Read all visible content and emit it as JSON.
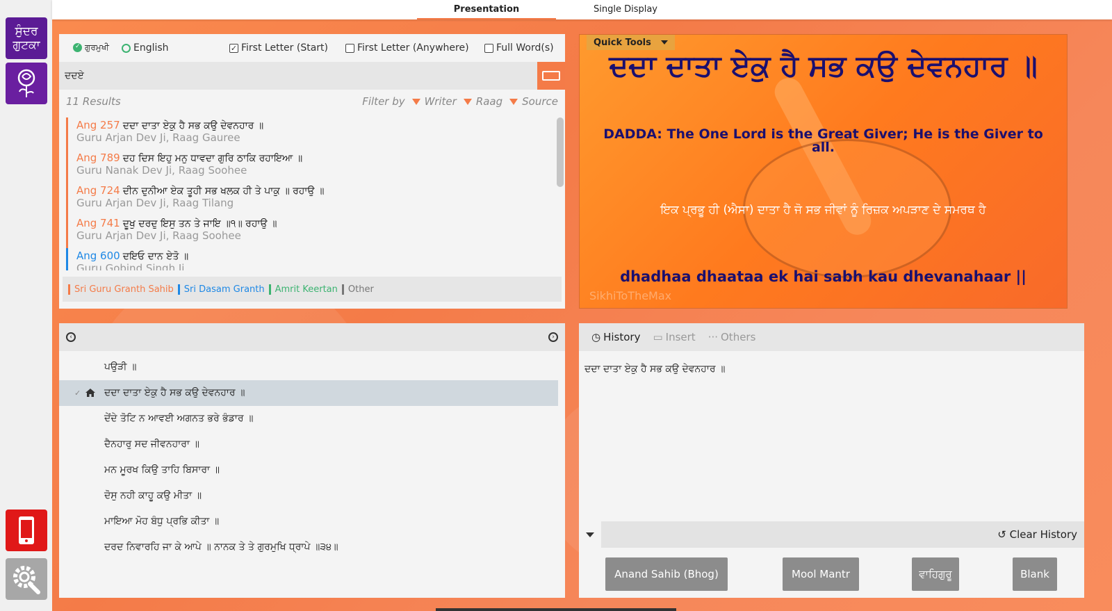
{
  "sidebar": {
    "gutka_label": "ਸੁੰਦਰ ਗੁਟਕਾ",
    "icons": [
      "rose-icon",
      "mobile-icon",
      "settings-icon"
    ]
  },
  "tabs": {
    "presentation": "Presentation",
    "single_display": "Single Display"
  },
  "search": {
    "options": {
      "gurmukhi": "ਗੁਰਮੁਖੀ",
      "english": "English",
      "first_letter_start": "First Letter (Start)",
      "first_letter_anywhere": "First Letter (Anywhere)",
      "full_words": "Full Word(s)"
    },
    "query": "ਦਦਏ",
    "results_count": "11 Results",
    "filter_by": "Filter by",
    "filters": [
      "Writer",
      "Raag",
      "Source"
    ],
    "results": [
      {
        "ang": "Ang 257",
        "text": "ਦਦਾ ਦਾਤਾ ਏਕੁ ਹੈ ਸਭ ਕਉ ਦੇਵਨਹਾਰ ॥",
        "sub": "Guru Arjan Dev Ji, Raag Gauree"
      },
      {
        "ang": "Ang 789",
        "text": "ਦਹ ਦਿਸ ਇਹੁ ਮਨੁ ਧਾਵਦਾ ਗੁਰਿ ਠਾਕਿ ਰਹਾਇਆ ॥",
        "sub": "Guru Nanak Dev Ji, Raag Soohee"
      },
      {
        "ang": "Ang 724",
        "text": "ਦੀਨ ਦੁਨੀਆ ਏਕ ਤੂਹੀ ਸਭ ਖਲਕ ਹੀ ਤੇ ਪਾਕੁ ॥ ਰਹਾਉ ॥",
        "sub": "Guru Arjan Dev Ji, Raag Tilang"
      },
      {
        "ang": "Ang 741",
        "text": "ਦੂਖੁ ਦਰਦੁ ਇਸੁ ਤਨ ਤੇ ਜਾਇ ॥੧॥ ਰਹਾਉ ॥",
        "sub": "Guru Arjan Dev Ji, Raag Soohee"
      },
      {
        "ang": "Ang 600",
        "text": "ਦਇਓ ਦਾਨ ਏਤੋ ॥",
        "sub": "Guru Gobind Singh Ji"
      }
    ],
    "sources": [
      {
        "label": "Sri Guru Granth Sahib",
        "color": "#f47b48"
      },
      {
        "label": "Sri Dasam Granth",
        "color": "#1e88e5"
      },
      {
        "label": "Amrit Keertan",
        "color": "#3cb371"
      },
      {
        "label": "Other",
        "color": "#777777"
      }
    ]
  },
  "preview": {
    "quick_tools": "Quick Tools",
    "gurmukhi": "ਦਦਾ ਦਾਤਾ ਏਕੁ ਹੈ ਸਭ ਕਉ ਦੇਵਨਹਾਰ ॥",
    "english": "DADDA: The One Lord is the Great Giver; He is the Giver to all.",
    "punjabi": "ਇਕ ਪ੍ਰਭੂ ਹੀ (ਐਸਾ) ਦਾਤਾ ਹੈ ਜੋ ਸਭ ਜੀਵਾਂ ਨੂੰ ਰਿਜ਼ਕ ਅਪੜਾਣ ਦੇ ਸਮਰਥ ਹੈ",
    "transliteration": "dhadhaa dhaataa ek hai sabh kau dhevanahaar ||",
    "watermark": "SikhiToTheMax"
  },
  "shabad": {
    "lines": [
      {
        "text": "ਪਉੜੀ ॥",
        "current": false
      },
      {
        "text": "ਦਦਾ ਦਾਤਾ ਏਕੁ ਹੈ ਸਭ ਕਉ ਦੇਵਨਹਾਰ ॥",
        "current": true
      },
      {
        "text": "ਦੇਂਦੇ ਤੋਟਿ ਨ ਆਵਈ ਅਗਨਤ ਭਰੇ ਭੰਡਾਰ ॥",
        "current": false
      },
      {
        "text": "ਦੈਨਹਾਰੁ ਸਦ ਜੀਵਨਹਾਰਾ ॥",
        "current": false
      },
      {
        "text": "ਮਨ ਮੂਰਖ ਕਿਉ ਤਾਹਿ ਬਿਸਾਰਾ ॥",
        "current": false
      },
      {
        "text": "ਦੋਸੁ ਨਹੀ ਕਾਹੂ ਕਉ ਮੀਤਾ ॥",
        "current": false
      },
      {
        "text": "ਮਾਇਆ ਮੋਹ ਬੰਧੁ ਪ੍ਰਭਿ ਕੀਤਾ ॥",
        "current": false
      },
      {
        "text": "ਦਰਦ ਨਿਵਾਰਹਿ ਜਾ ਕੇ ਆਪੇ ॥ ਨਾਨਕ ਤੇ ਤੇ ਗੁਰਮੁਖਿ ਧ੍ਰਾਪੇ ॥੩੪॥",
        "current": false
      }
    ]
  },
  "history": {
    "tabs": [
      "History",
      "Insert",
      "Others"
    ],
    "items": [
      "ਦਦਾ ਦਾਤਾ ਏਕੁ ਹੈ ਸਭ ਕਉ ਦੇਵਨਹਾਰ ॥"
    ],
    "clear_label": "Clear History",
    "quick_buttons": [
      "Anand Sahib (Bhog)",
      "Mool Mantr",
      "ਵਾਹਿਗੁਰੂ",
      "Blank"
    ]
  }
}
